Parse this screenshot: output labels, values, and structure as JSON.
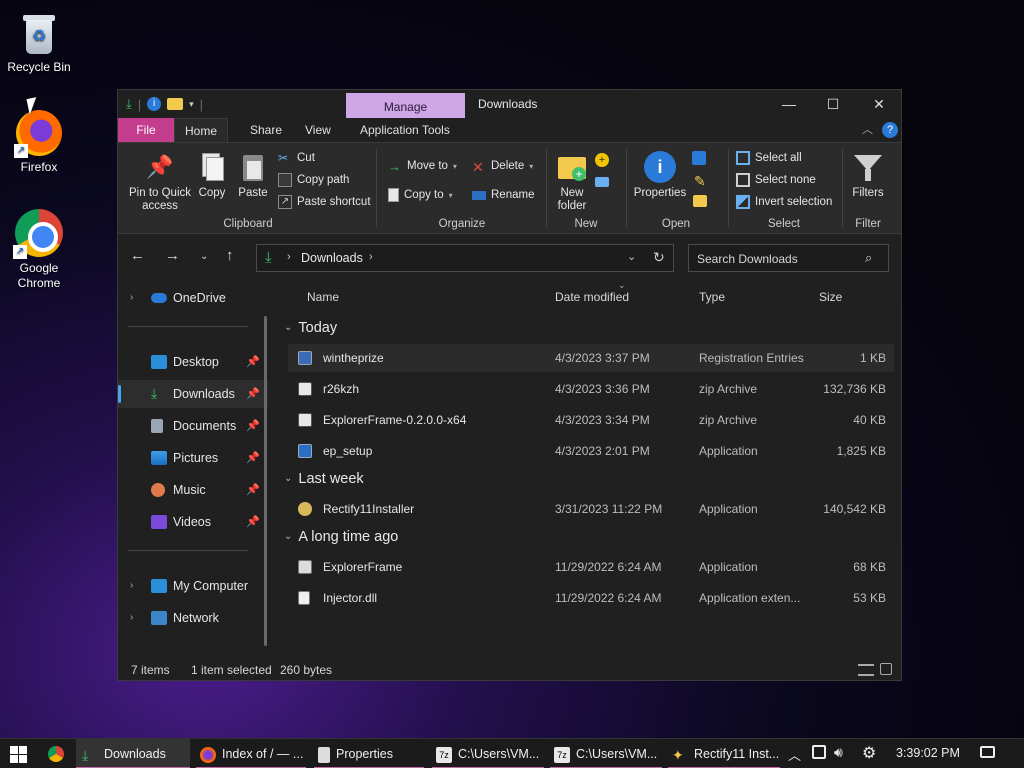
{
  "desktop": {
    "icons": [
      {
        "label": "Recycle Bin"
      },
      {
        "label": "Firefox"
      },
      {
        "label": "Google Chrome"
      }
    ]
  },
  "window": {
    "title": "Downloads",
    "manage_label": "Manage",
    "ribbon_tabs": [
      "File",
      "Home",
      "Share",
      "View",
      "Application Tools"
    ],
    "clipboard": {
      "pin_label": "Pin to Quick access",
      "copy_label": "Copy",
      "paste_label": "Paste",
      "cut_label": "Cut",
      "copy_path_label": "Copy path",
      "paste_shortcut_label": "Paste shortcut",
      "group_label": "Clipboard"
    },
    "organize": {
      "move_to_label": "Move to",
      "copy_to_label": "Copy to",
      "delete_label": "Delete",
      "rename_label": "Rename",
      "group_label": "Organize"
    },
    "new_group": {
      "new_folder_label": "New folder",
      "group_label": "New"
    },
    "open_group": {
      "properties_label": "Properties",
      "group_label": "Open"
    },
    "select_group": {
      "select_all_label": "Select all",
      "select_none_label": "Select none",
      "invert_label": "Invert selection",
      "group_label": "Select"
    },
    "filter_group": {
      "filters_label": "Filters",
      "group_label": "Filter"
    },
    "address": {
      "path": "Downloads"
    },
    "search": {
      "placeholder": "Search Downloads"
    },
    "nav_pane": {
      "onedrive": "OneDrive",
      "quick": [
        "Desktop",
        "Downloads",
        "Documents",
        "Pictures",
        "Music",
        "Videos"
      ],
      "my_computer": "My Computer",
      "network": "Network"
    },
    "columns": {
      "name": "Name",
      "date": "Date modified",
      "type": "Type",
      "size": "Size"
    },
    "groups": [
      {
        "title": "Today",
        "files": [
          {
            "name": "wintheprize",
            "date": "4/3/2023 3:37 PM",
            "type": "Registration Entries",
            "size": "1 KB"
          },
          {
            "name": "r26kzh",
            "date": "4/3/2023 3:36 PM",
            "type": "zip Archive",
            "size": "132,736 KB"
          },
          {
            "name": "ExplorerFrame-0.2.0.0-x64",
            "date": "4/3/2023 3:34 PM",
            "type": "zip Archive",
            "size": "40 KB"
          },
          {
            "name": "ep_setup",
            "date": "4/3/2023 2:01 PM",
            "type": "Application",
            "size": "1,825 KB"
          }
        ]
      },
      {
        "title": "Last week",
        "files": [
          {
            "name": "Rectify11Installer",
            "date": "3/31/2023 11:22 PM",
            "type": "Application",
            "size": "140,542 KB"
          }
        ]
      },
      {
        "title": "A long time ago",
        "files": [
          {
            "name": "ExplorerFrame",
            "date": "11/29/2022 6:24 AM",
            "type": "Application",
            "size": "68 KB"
          },
          {
            "name": "Injector.dll",
            "date": "11/29/2022 6:24 AM",
            "type": "Application exten...",
            "size": "53 KB"
          }
        ]
      }
    ],
    "status": {
      "items": "7 items",
      "selected": "1 item selected",
      "bytes": "260 bytes"
    }
  },
  "taskbar": {
    "items": [
      {
        "label": "Downloads"
      },
      {
        "label": "Index of / — ..."
      },
      {
        "label": "Properties"
      },
      {
        "label": "C:\\Users\\VM..."
      },
      {
        "label": "C:\\Users\\VM..."
      },
      {
        "label": "Rectify11 Inst..."
      }
    ],
    "clock": "3:39:02 PM"
  },
  "colors": {
    "file_tab": "#c43c8e",
    "manage_tab": "#cfa6e6",
    "accent": "#4aa3f0",
    "window_bg": "#202020"
  }
}
